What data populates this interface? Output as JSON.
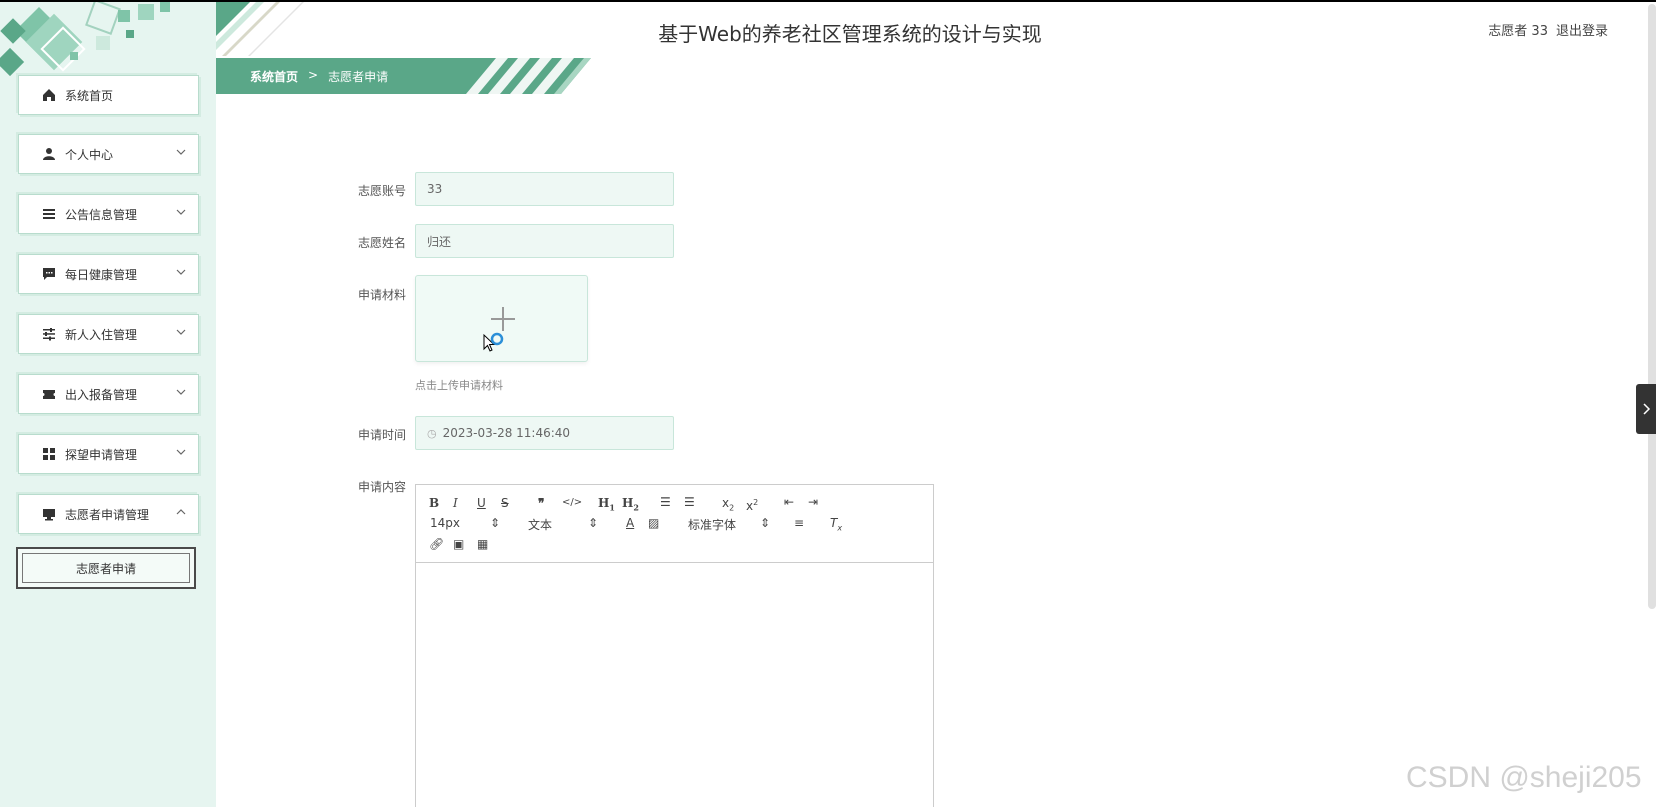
{
  "header": {
    "title": "基于Web的养老社区管理系统的设计与实现",
    "user": "志愿者 33",
    "logout": "退出登录"
  },
  "breadcrumb": {
    "home": "系统首页",
    "separator": ">",
    "current": "志愿者申请"
  },
  "sidebar": {
    "items": [
      {
        "label": "系统首页",
        "icon": "home-icon",
        "expandable": false
      },
      {
        "label": "个人中心",
        "icon": "user-icon",
        "expandable": true
      },
      {
        "label": "公告信息管理",
        "icon": "list-icon",
        "expandable": true
      },
      {
        "label": "每日健康管理",
        "icon": "chat-icon",
        "expandable": true
      },
      {
        "label": "新人入住管理",
        "icon": "sliders-icon",
        "expandable": true
      },
      {
        "label": "出入报备管理",
        "icon": "ticket-icon",
        "expandable": true
      },
      {
        "label": "探望申请管理",
        "icon": "grid-icon",
        "expandable": true
      },
      {
        "label": "志愿者申请管理",
        "icon": "monitor-icon",
        "expandable": true,
        "expanded": true
      }
    ],
    "submenu": {
      "label": "志愿者申请"
    }
  },
  "form": {
    "account": {
      "label": "志愿账号",
      "value": "33"
    },
    "name": {
      "label": "志愿姓名",
      "value": "归还"
    },
    "material": {
      "label": "申请材料",
      "hint": "点击上传申请材料"
    },
    "time": {
      "label": "申请时间",
      "value": "2023-03-28 11:46:40"
    },
    "content": {
      "label": "申请内容"
    }
  },
  "editor": {
    "font_size": "14px",
    "block_format": "文本",
    "font_family": "标准字体",
    "buttons": [
      "B",
      "I",
      "U",
      "S",
      "quote",
      "code",
      "H1",
      "H2",
      "ol",
      "ul",
      "x2-sub",
      "x2-sup",
      "outdent",
      "indent",
      "color",
      "background",
      "align",
      "clean",
      "link",
      "image",
      "video"
    ]
  },
  "watermark": "CSDN @sheji205",
  "colors": {
    "accent": "#5aa788",
    "sidebar_bg": "#e6f5f0"
  }
}
